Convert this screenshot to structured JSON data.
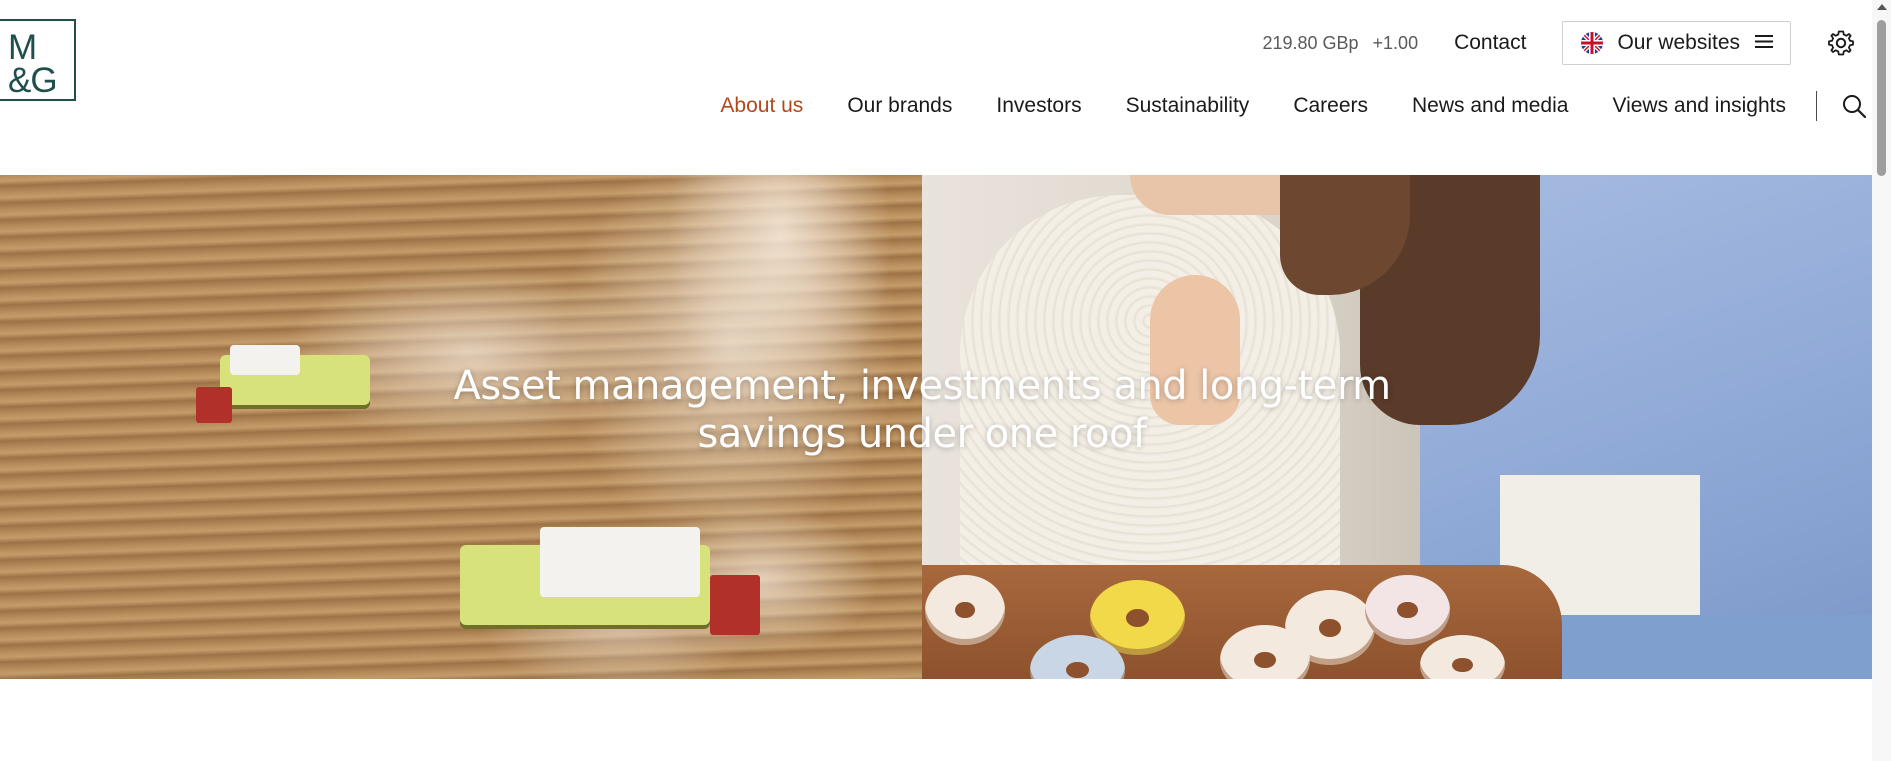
{
  "brand": {
    "logo_line1": "M",
    "logo_line2": "&G",
    "color": "#1e4f4a"
  },
  "topbar": {
    "share_price": "219.80 GBp",
    "share_change": "+1.00",
    "contact_label": "Contact",
    "websites_label": "Our websites",
    "flag_icon": "uk-flag-icon",
    "menu_icon": "hamburger-icon",
    "settings_icon": "gear-icon"
  },
  "nav": {
    "items": [
      {
        "label": "About us",
        "active": true
      },
      {
        "label": "Our brands"
      },
      {
        "label": "Investors"
      },
      {
        "label": "Sustainability"
      },
      {
        "label": "Careers"
      },
      {
        "label": "News and media"
      },
      {
        "label": "Views and insights"
      }
    ],
    "search_icon": "search-icon",
    "active_color": "#b1491c"
  },
  "hero": {
    "headline_line1": "Asset management, investments and long-term",
    "headline_line2": "savings under one roof"
  }
}
